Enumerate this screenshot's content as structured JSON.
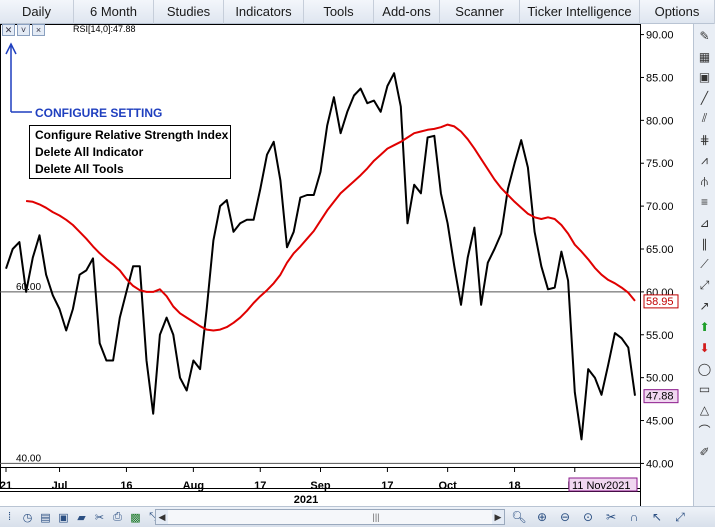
{
  "menu": {
    "items": [
      {
        "label": "Daily",
        "name": "menu-daily"
      },
      {
        "label": "6 Month",
        "name": "menu-6-month"
      },
      {
        "label": "Studies",
        "name": "menu-studies"
      },
      {
        "label": "Indicators",
        "name": "menu-indicators"
      },
      {
        "label": "Tools",
        "name": "menu-tools"
      },
      {
        "label": "Add-ons",
        "name": "menu-add-ons"
      },
      {
        "label": "Scanner",
        "name": "menu-scanner"
      },
      {
        "label": "Ticker Intelligence",
        "name": "menu-ticker-intelligence"
      },
      {
        "label": "Options",
        "name": "menu-options"
      }
    ]
  },
  "indicator": {
    "label": "RSI[14,0]:47.88",
    "configure_label": "CONFIGURE SETTING"
  },
  "context_menu": {
    "items": [
      "Configure Relative Strength Index",
      "Delete All Indicator",
      "Delete All Tools"
    ]
  },
  "chart_data": {
    "type": "line",
    "ylim": [
      39,
      91
    ],
    "y_ticks": [
      "90.00",
      "85.00",
      "80.00",
      "75.00",
      "70.00",
      "65.00",
      "60.00",
      "55.00",
      "50.00",
      "45.00",
      "40.00"
    ],
    "y_tick_values": [
      90,
      85,
      80,
      75,
      70,
      65,
      60,
      55,
      50,
      45,
      40
    ],
    "reference_lines": [
      {
        "value": 60,
        "label": "60.00"
      },
      {
        "value": 40,
        "label": "40.00"
      }
    ],
    "x_labels": [
      "21",
      "Jul",
      "16",
      "Aug",
      "17",
      "Sep",
      "17",
      "Oct",
      "18",
      "No"
    ],
    "x_label_index": [
      0,
      8,
      18,
      28,
      38,
      47,
      57,
      66,
      76,
      85
    ],
    "year_label": "2021",
    "date_badge": "11 Nov2021",
    "series": [
      {
        "name": "RSI",
        "color": "#000000",
        "values": [
          62.7,
          65.0,
          65.8,
          60.0,
          64.0,
          66.6,
          62.0,
          59.6,
          58.0,
          55.5,
          58.0,
          62.0,
          62.5,
          63.9,
          54.0,
          52.0,
          52.0,
          57.0,
          60.0,
          63.0,
          63.0,
          52.0,
          45.8,
          55.0,
          57.0,
          55.0,
          50.0,
          48.5,
          52.0,
          51.0,
          58.0,
          66.0,
          70.0,
          70.7,
          67.0,
          68.0,
          68.4,
          68.4,
          72.0,
          76.0,
          77.5,
          73.0,
          65.2,
          67.0,
          71.0,
          71.3,
          71.3,
          74.0,
          79.4,
          82.7,
          78.5,
          81.0,
          82.9,
          83.7,
          82.0,
          82.3,
          81.0,
          84.0,
          85.5,
          81.6,
          68.0,
          72.5,
          71.5,
          78.0,
          78.2,
          71.5,
          68.0,
          63.0,
          58.5,
          64.0,
          67.5,
          58.5,
          63.4,
          65.0,
          66.8,
          72.0,
          75.0,
          77.7,
          74.5,
          67.0,
          63.0,
          60.3,
          60.5,
          64.7,
          61.3,
          48.3,
          42.8,
          51.0,
          50.0,
          48.0,
          51.5,
          55.2,
          54.6,
          53.5,
          47.9
        ],
        "last_value": "47.88"
      },
      {
        "name": "MA",
        "color": "#e00000",
        "values": [
          70.6,
          70.5,
          70.2,
          69.8,
          69.3,
          68.9,
          68.4,
          67.8,
          67.0,
          66.2,
          65.3,
          64.5,
          63.8,
          63.2,
          62.5,
          61.5,
          60.7,
          60.2,
          60.0,
          60.0,
          60.3,
          59.5,
          58.3,
          57.5,
          57.0,
          56.5,
          56.0,
          55.6,
          55.5,
          55.6,
          55.9,
          56.4,
          57.0,
          57.8,
          58.7,
          59.5,
          60.2,
          61.0,
          62.0,
          63.4,
          64.5,
          65.3,
          66.2,
          67.1,
          68.3,
          69.5,
          70.5,
          71.5,
          72.2,
          72.9,
          73.6,
          74.4,
          75.3,
          76.0,
          76.7,
          77.1,
          77.5,
          78.0,
          78.5,
          78.7,
          78.9,
          79.0,
          79.2,
          79.5,
          79.3,
          78.7,
          77.8,
          76.7,
          75.5,
          74.3,
          73.1,
          72.1,
          71.3,
          70.5,
          69.8,
          69.1,
          68.7,
          68.5,
          68.7,
          68.5,
          67.8,
          66.8,
          65.5,
          64.7,
          63.8,
          62.8,
          62.0,
          61.4,
          61.0,
          60.5,
          59.9,
          58.95
        ],
        "last_value": "58.95"
      }
    ],
    "colors": {
      "rsi_badge_border": "#c00000",
      "rsi_badge_text": "#c00000",
      "last_badge_bg": "#f0d7f0",
      "last_badge_border": "#8b1a8b"
    }
  }
}
